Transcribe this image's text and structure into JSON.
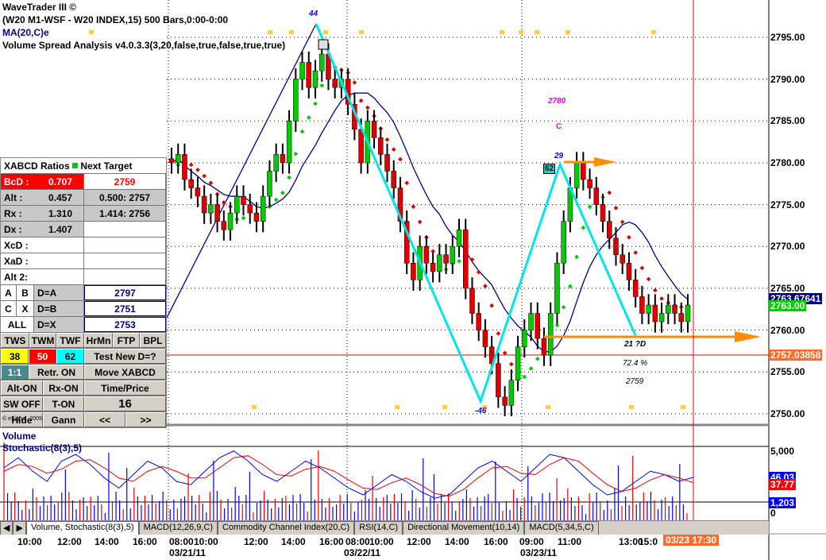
{
  "header": {
    "app_title": "WaveTrader III ©",
    "symbol_line": "(W20 M1-WSF - W20 INDEX,15) 500 Bars,0:00-0:00",
    "ma_label": "MA(20,C)e",
    "vsa_label": "Volume Spread Analysis v4.0.3.3(3,20,false,true,false,true,true)"
  },
  "xabcd": {
    "header": "XABCD Ratios",
    "header2": "Next Target",
    "rows": [
      {
        "label": "BcD :",
        "value": "0.707",
        "target": "2759"
      },
      {
        "label": "Alt  :",
        "value": "0.457",
        "target": "0.500: 2757"
      },
      {
        "label": "Rx  :",
        "value": "1.310",
        "target": "1.414: 2756"
      },
      {
        "label": "Dx  :",
        "value": "1.407",
        "target": ""
      },
      {
        "label": "XcD :",
        "value": "",
        "target": ""
      },
      {
        "label": "XaD :",
        "value": "",
        "target": ""
      },
      {
        "label": "Alt 2:",
        "value": "",
        "target": ""
      }
    ],
    "d_rows": [
      {
        "b1": "A",
        "b2": "B",
        "label": "D=A",
        "value": "2797"
      },
      {
        "b1": "C",
        "b2": "X",
        "label": "D=B",
        "value": "2751"
      },
      {
        "b1": "ALL",
        "b2": "",
        "label": "D=X",
        "value": "2753"
      }
    ],
    "buttons": {
      "tws": "TWS",
      "twm": "TWM",
      "twf": "TWF",
      "hrmn": "HrMn",
      "ftp": "FTP",
      "bpl": "BPL",
      "f38": "38",
      "f50": "50",
      "f62": "62",
      "test": "Test New D=?",
      "one": "1:1",
      "retr": "Retr. ON",
      "move": "Move XABCD",
      "alt": "Alt-ON",
      "rx": "Rx-ON",
      "tp": "Time/Price",
      "sw": "SW OFF",
      "ton": "T-ON",
      "num": "16",
      "hide": "Hide",
      "gann": "Gann",
      "prev": "<<",
      "next": ">>"
    },
    "copyright": "© eSignal, 2009"
  },
  "annotations": {
    "x": "44",
    "a": "-46",
    "b": "29",
    "b_box": "62",
    "c_price": "2780",
    "c_label": "C",
    "d": "21 ?D",
    "pct": "72.4 %",
    "target": "2759"
  },
  "price_axis": {
    "ticks": [
      "2795.00",
      "2790.00",
      "2785.00",
      "2780.00",
      "2775.00",
      "2770.00",
      "2765.00",
      "2760.00",
      "2755.00",
      "2750.00"
    ],
    "ma_value": "2763.67641",
    "last": "2763.00",
    "cursor": "2757.03858"
  },
  "lower_panel": {
    "volume_label": "Volume",
    "stoch_label": "Stochastic(8(3),5)",
    "ticks": [
      "5,000",
      "0"
    ],
    "k": "46.03",
    "d": "37.77",
    "vol": "1,203"
  },
  "tabs": [
    "Volume, Stochastic(8(3),5)",
    "MACD(12,26,9,C)",
    "Commodity Channel Index(20,C)",
    "RSI(14,C)",
    "Directional Movement(10,14)",
    "MACD(5,34,5,C)"
  ],
  "time_axis": {
    "times": [
      "10:00",
      "12:00",
      "14:00",
      "16:00",
      "08:00",
      "10:00",
      "12:00",
      "14:00",
      "16:00",
      "08:00",
      "10:00",
      "12:00",
      "14:00",
      "16:00",
      "09:00",
      "11:00",
      "13:00",
      "15:0"
    ],
    "dates": [
      "03/21/11",
      "03/22/11",
      "03/23/11"
    ],
    "cursor": "03/23 17:30"
  },
  "colors": {
    "up": "#00cc00",
    "down": "#e00000",
    "cyan": "#00e5ee",
    "ma": "#00008b",
    "orange": "#ff8c00"
  },
  "chart_data": {
    "type": "line",
    "title": "W20 INDEX 15-min",
    "ylim": [
      2748,
      2797
    ],
    "closes": [
      2780,
      2781,
      2778,
      2777,
      2776,
      2774,
      2775,
      2773,
      2772,
      2774,
      2776,
      2775,
      2774,
      2773,
      2776,
      2779,
      2781,
      2780,
      2785,
      2790,
      2792,
      2789,
      2791,
      2793,
      2790,
      2789,
      2790,
      2787,
      2784,
      2780,
      2785,
      2783,
      2781,
      2779,
      2777,
      2773,
      2768,
      2766,
      2770,
      2768,
      2767,
      2769,
      2768,
      2770,
      2772,
      2765,
      2762,
      2760,
      2758,
      2756,
      2752,
      2751,
      2754,
      2758,
      2760,
      2762,
      2759,
      2757,
      2762,
      2768,
      2773,
      2777,
      2780,
      2778,
      2777,
      2775,
      2773,
      2771,
      2769,
      2768,
      2766,
      2764,
      2762,
      2763,
      2761,
      2762,
      2763,
      2762,
      2761,
      2763
    ],
    "stoch_k": [
      60,
      75,
      55,
      40,
      70,
      80,
      65,
      45,
      30,
      50,
      70,
      60,
      40,
      35,
      55,
      75,
      85,
      70,
      50,
      40,
      55,
      70,
      60,
      45,
      30,
      20,
      35,
      50,
      40,
      25,
      15,
      20,
      40,
      60,
      70,
      55,
      40,
      60,
      80,
      75,
      55,
      35,
      20,
      25,
      40,
      55,
      50,
      40,
      46
    ],
    "stoch_d": [
      55,
      65,
      62,
      52,
      58,
      70,
      72,
      60,
      45,
      40,
      55,
      62,
      55,
      45,
      45,
      60,
      75,
      78,
      65,
      50,
      48,
      58,
      62,
      55,
      42,
      30,
      28,
      38,
      45,
      35,
      22,
      18,
      28,
      45,
      60,
      62,
      52,
      50,
      65,
      75,
      70,
      52,
      35,
      25,
      30,
      42,
      50,
      45,
      38
    ]
  }
}
